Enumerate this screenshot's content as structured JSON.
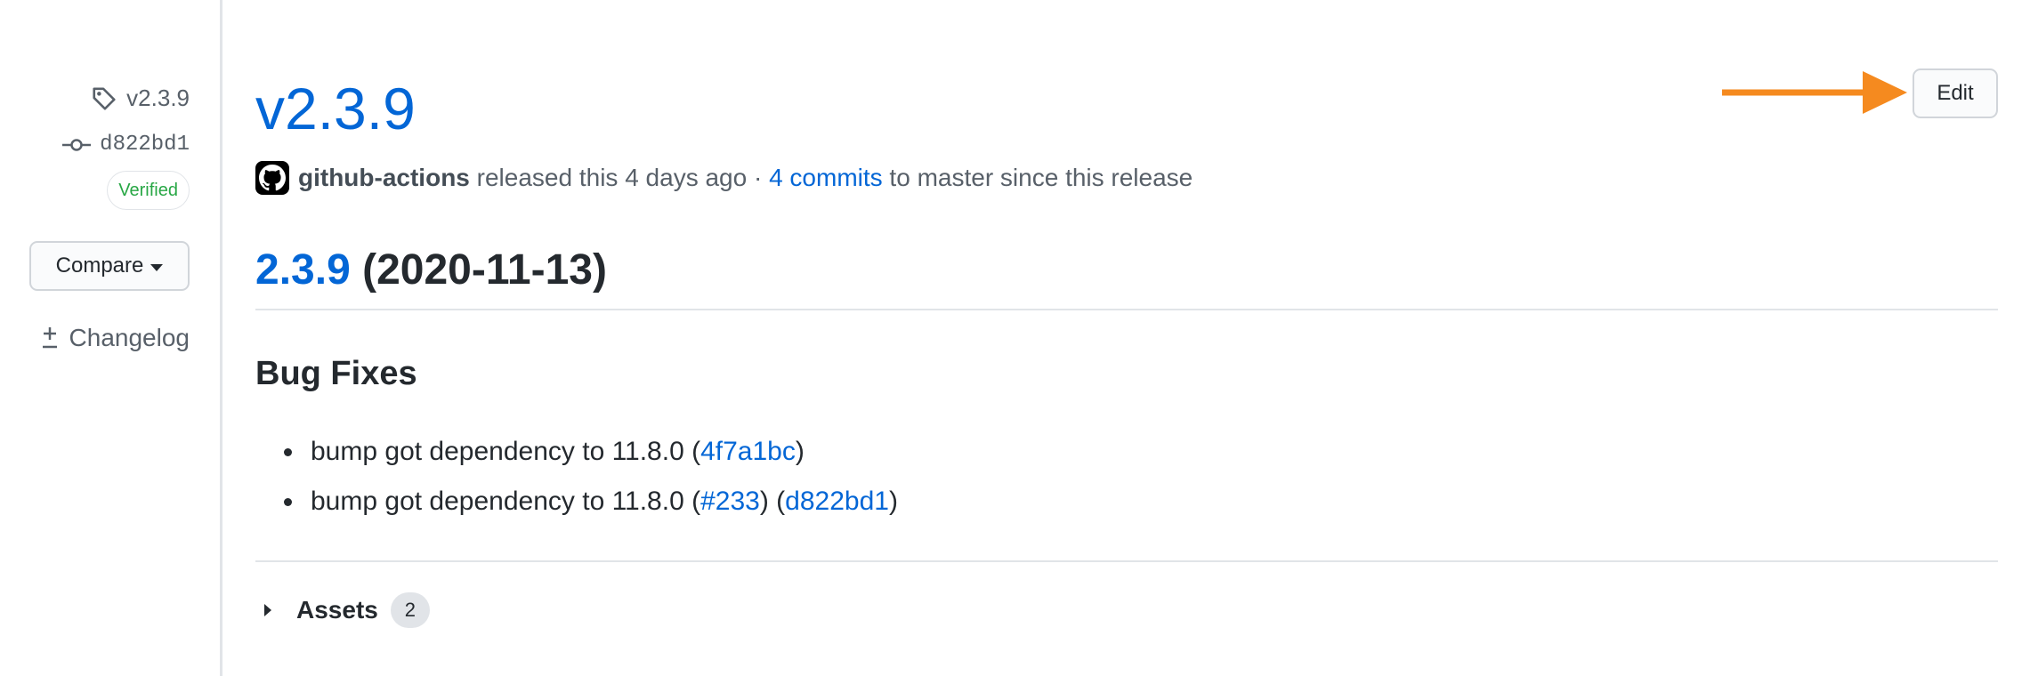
{
  "sidebar": {
    "tag": "v2.3.9",
    "commit": "d822bd1",
    "verified": "Verified",
    "compare_label": "Compare",
    "changelog_label": "Changelog"
  },
  "release": {
    "title": "v2.3.9",
    "edit_label": "Edit",
    "author": "github-actions",
    "released_text": " released this 4 days ago · ",
    "commits_link": "4 commits",
    "commits_suffix": " to master since this release",
    "version_link": "2.3.9",
    "version_date": " (2020-11-13)",
    "bug_fixes_heading": "Bug Fixes",
    "fixes": [
      {
        "text": "bump got dependency to 11.8.0 (",
        "commit": "4f7a1bc",
        "close": ")"
      },
      {
        "text": "bump got dependency to 11.8.0 (",
        "pr": "#233",
        "middle": ") (",
        "commit": "d822bd1",
        "close": ")"
      }
    ],
    "assets_label": "Assets",
    "assets_count": "2"
  },
  "colors": {
    "link": "#0366d6",
    "arrow": "#f58a1f",
    "verified": "#28a745"
  }
}
